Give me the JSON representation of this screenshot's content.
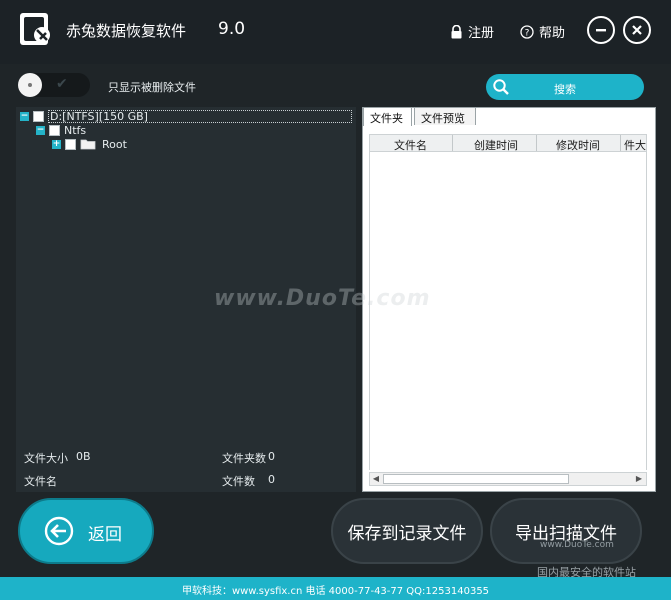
{
  "app": {
    "title": "赤兔数据恢复软件",
    "version": "9.0"
  },
  "header": {
    "register_label": "注册",
    "help_label": "帮助"
  },
  "filter": {
    "label": "只显示被删除文件",
    "enabled": false
  },
  "search": {
    "label": "搜索"
  },
  "tree": {
    "drive_label": "D:[NTFS][150 GB]",
    "ntfs_label": "Ntfs",
    "root_label": "Root"
  },
  "info": {
    "size_label": "文件大小",
    "size_value": "0B",
    "filename_label": "文件名",
    "folder_count_label": "文件夹数",
    "folder_count_value": "0",
    "file_count_label": "文件数",
    "file_count_value": "0"
  },
  "tabs": [
    {
      "label": "文件夹"
    },
    {
      "label": "文件预览"
    }
  ],
  "list": {
    "columns": [
      "文件名",
      "创建时间",
      "修改时间",
      "件大"
    ]
  },
  "buttons": {
    "back_label": "返回",
    "save_label": "保存到记录文件",
    "export_label": "导出扫描文件"
  },
  "footer": {
    "text": "甲软科技：www.sysfix.cn 电话 4000-77-43-77 QQ:1253140355"
  },
  "watermarks": {
    "main": "www.DuoTe.com",
    "site": "www.DuoTe.com",
    "slogan": "国内最安全的软件站"
  },
  "colors": {
    "accent": "#1eb3c9",
    "background": "#1f2528",
    "panel": "#262e32"
  }
}
